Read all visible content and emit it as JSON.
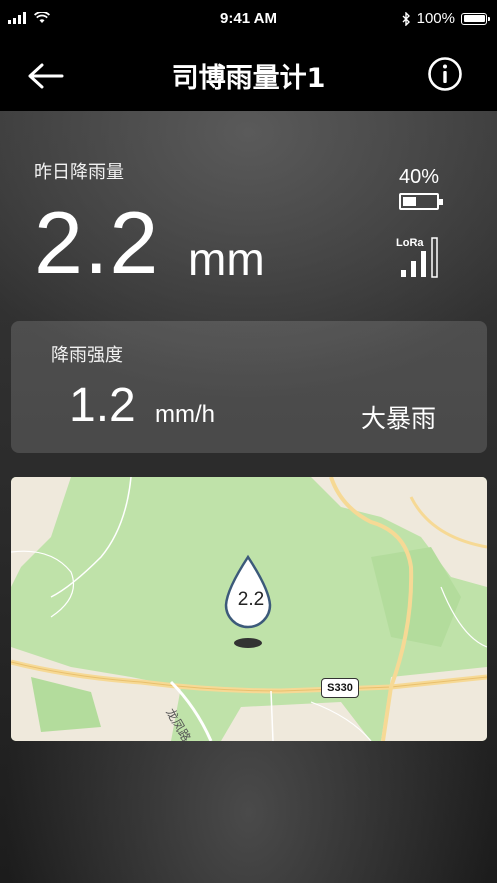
{
  "status_bar": {
    "time": "9:41 AM",
    "battery": "100%"
  },
  "header": {
    "title": "司博雨量计1"
  },
  "rainfall": {
    "label": "昨日降雨量",
    "value": "2.2",
    "unit": "mm"
  },
  "device": {
    "battery_percent": "40%",
    "battery_level": 0.4,
    "network": "LoRa",
    "signal_level": 3
  },
  "intensity": {
    "label": "降雨强度",
    "value": "1.2",
    "unit": "mm/h",
    "level": "大暴雨"
  },
  "map": {
    "marker_value": "2.2",
    "road_shield": "S330",
    "road_name": "龙凤路"
  },
  "colors": {
    "map_green": "#bfe2a9",
    "map_road": "#f6d995",
    "map_land": "#efe9dc",
    "marker_outline": "#3c5a7a"
  }
}
